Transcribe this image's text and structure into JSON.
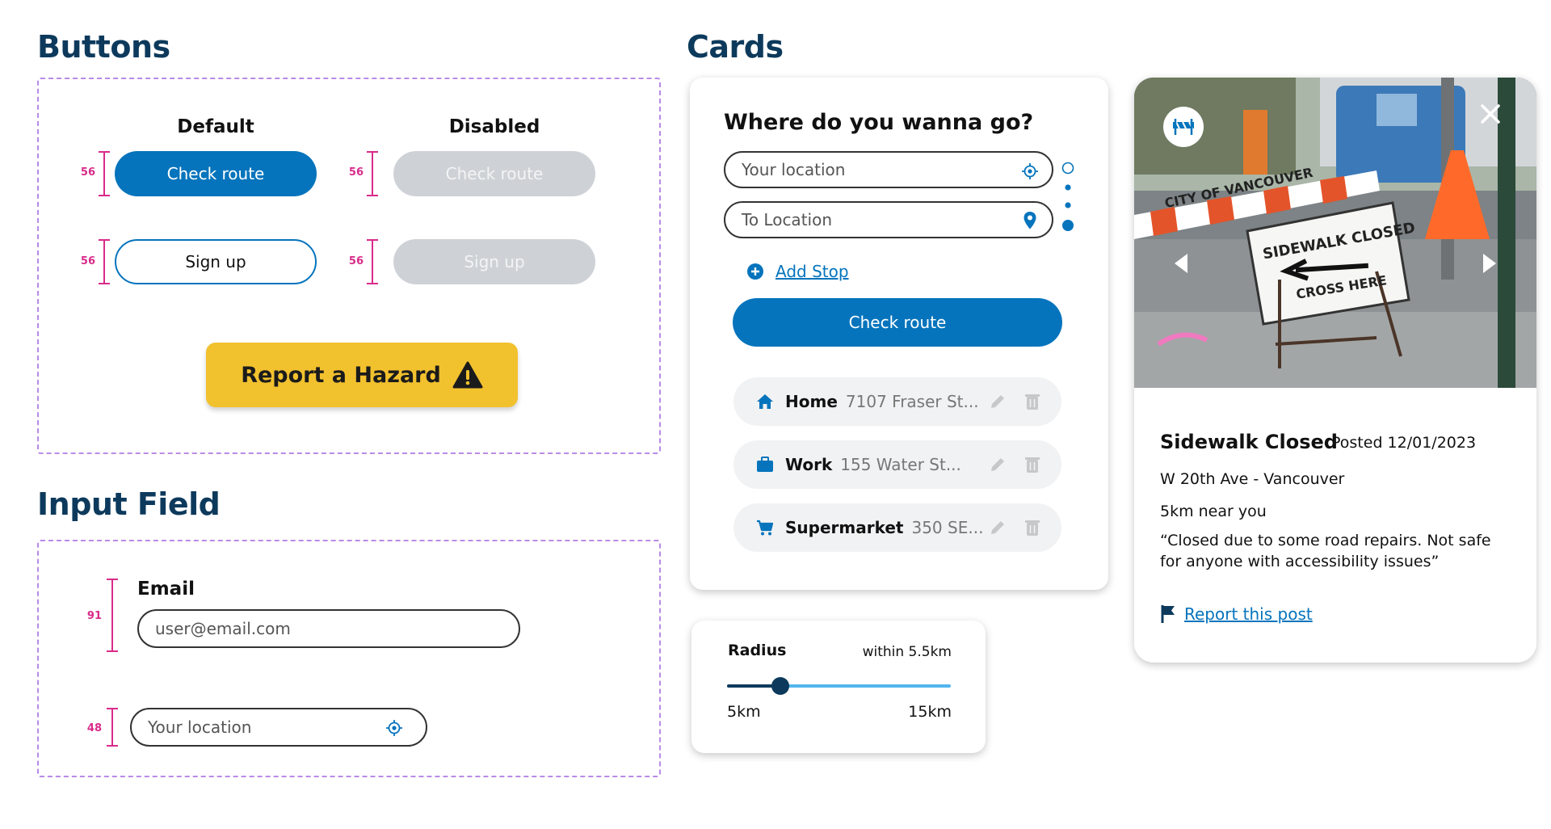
{
  "sections": {
    "buttons_title": "Buttons",
    "cards_title": "Cards",
    "input_title": "Input Field"
  },
  "buttons": {
    "default_heading": "Default",
    "disabled_heading": "Disabled",
    "check_route": "Check route",
    "sign_up": "Sign up",
    "report_hazard": "Report a Hazard",
    "measure_56": "56"
  },
  "inputs": {
    "email_label": "Email",
    "email_placeholder": "user@email.com",
    "location_placeholder": "Your location",
    "measure_91": "91",
    "measure_48": "48"
  },
  "route_card": {
    "title": "Where do you wanna go?",
    "from_placeholder": "Your location",
    "to_placeholder": "To Location",
    "add_stop": "Add Stop",
    "check_route": "Check route",
    "places": [
      {
        "name": "Home",
        "address": "7107 Fraser St..."
      },
      {
        "name": "Work",
        "address": "155 Water St..."
      },
      {
        "name": "Supermarket",
        "address": "350 SE..."
      }
    ]
  },
  "radius_card": {
    "label": "Radius",
    "value_text": "within 5.5km",
    "min_label": "5km",
    "max_label": "15km",
    "slider_fraction": 0.24
  },
  "hazard_card": {
    "photo_sign_1": "CITY OF VANCOUVER",
    "photo_sign_2": "SIDEWALK CLOSED",
    "photo_sign_3": "CROSS HERE",
    "title": "Sidewalk Closed",
    "posted": "Posted 12/01/2023",
    "location": "W 20th Ave - Vancouver",
    "distance": "5km near you",
    "quote": "“Closed due to some road repairs. Not safe for anyone with accessibility issues”",
    "report_link": "Report this post"
  },
  "colors": {
    "primary": "#0574bc",
    "heading": "#0d3a5c",
    "hazard_yellow": "#f2c12e",
    "disabled": "#ced2d6",
    "measure": "#d92b8a",
    "dashed_border": "#b98be6"
  }
}
